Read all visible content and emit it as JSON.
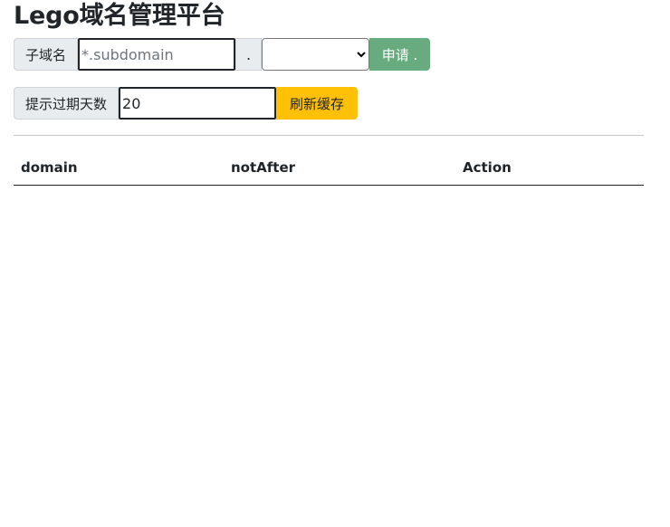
{
  "header": {
    "title": "Lego域名管理平台"
  },
  "apply_form": {
    "subdomain_label": "子域名",
    "subdomain_placeholder": "*.subdomain",
    "subdomain_value": "",
    "dot_separator": ".",
    "domain_select_value": "",
    "apply_label": "申请 ."
  },
  "refresh_form": {
    "days_label": "提示过期天数",
    "days_value": "20",
    "refresh_label": "刷新缓存"
  },
  "table": {
    "columns": [
      "domain",
      "notAfter",
      "Action"
    ],
    "rows": []
  },
  "colors": {
    "apply_button": "#67ab7e",
    "refresh_button": "#ffc107",
    "addon_background": "#e9ecef"
  }
}
